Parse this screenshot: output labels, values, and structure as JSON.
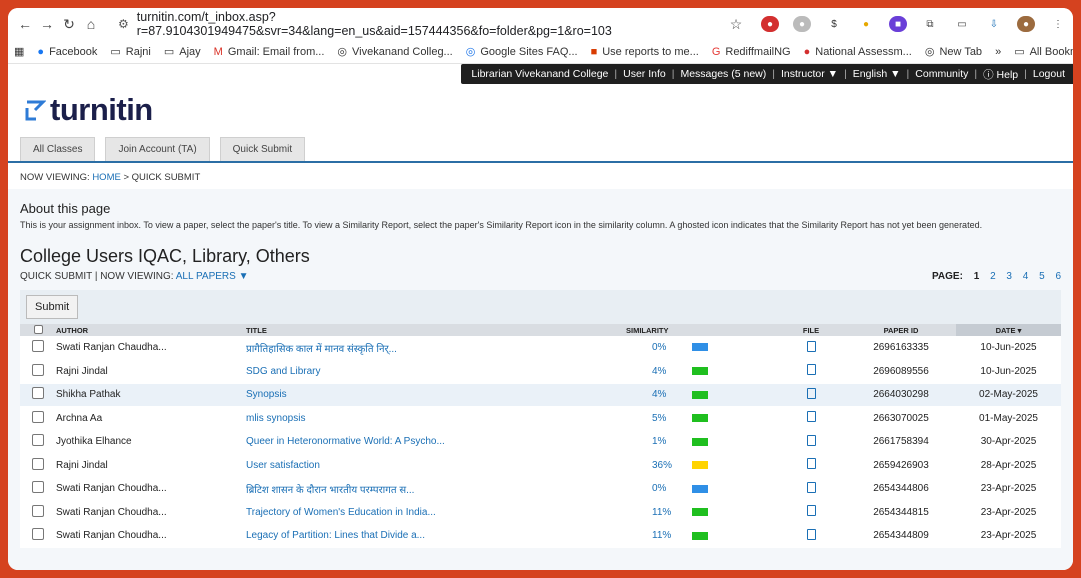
{
  "browser": {
    "url": "turnitin.com/t_inbox.asp?r=87.9104301949475&svr=34&lang=en_us&aid=157444356&fo=folder&pg=1&ro=103",
    "bookmarks": [
      "Facebook",
      "Rajni",
      "Ajay",
      "Gmail: Email from...",
      "Vivekanand Colleg...",
      "Google Sites FAQ...",
      "Use reports to me...",
      "RediffmailNG",
      "National Assessm...",
      "New Tab"
    ],
    "all_bookmarks": "All Bookmarks"
  },
  "topnav": [
    "Librarian Vivekanand College",
    "User Info",
    "Messages (5 new)",
    "Instructor ▼",
    "English ▼",
    "Community",
    "ⓘ Help",
    "Logout"
  ],
  "logo": "turnitin",
  "tabs": [
    "All Classes",
    "Join Account (TA)",
    "Quick Submit"
  ],
  "breadcrumb": {
    "prefix": "NOW VIEWING: ",
    "home": "HOME",
    "rest": " > QUICK SUBMIT"
  },
  "about": {
    "title": "About this page",
    "text": "This is your assignment inbox. To view a paper, select the paper's title. To view a Similarity Report, select the paper's Similarity Report icon in the similarity column. A ghosted icon indicates that the Similarity Report has not yet been generated."
  },
  "class_title": "College Users IQAC, Library, Others",
  "subline": {
    "prefix": "QUICK SUBMIT | NOW VIEWING: ",
    "link": "ALL PAPERS ▼"
  },
  "pager": {
    "label": "PAGE:",
    "pages": [
      "1",
      "2",
      "3",
      "4",
      "5",
      "6"
    ]
  },
  "submit": "Submit",
  "columns": [
    "AUTHOR",
    "TITLE",
    "SIMILARITY",
    "FILE",
    "PAPER ID",
    "DATE"
  ],
  "colors": {
    "blue": "#2f8fe6",
    "green": "#1fbf1f",
    "yellow": "#ffd400"
  },
  "rows": [
    {
      "author": "Swati Ranjan Chaudha...",
      "title": "प्रागैतिहासिक काल में मानव संस्कृति निर्...",
      "sim": "0%",
      "color": "blue",
      "id": "2696163335",
      "date": "10-Jun-2025"
    },
    {
      "author": "Rajni Jindal",
      "title": "SDG and Library",
      "sim": "4%",
      "color": "green",
      "id": "2696089556",
      "date": "10-Jun-2025"
    },
    {
      "author": "Shikha Pathak",
      "title": "Synopsis",
      "sim": "4%",
      "color": "green",
      "id": "2664030298",
      "date": "02-May-2025"
    },
    {
      "author": "Archna Aa",
      "title": "mlis synopsis",
      "sim": "5%",
      "color": "green",
      "id": "2663070025",
      "date": "01-May-2025"
    },
    {
      "author": "Jyothika Elhance",
      "title": "Queer in Heteronormative World: A Psycho...",
      "sim": "1%",
      "color": "green",
      "id": "2661758394",
      "date": "30-Apr-2025"
    },
    {
      "author": "Rajni Jindal",
      "title": "User satisfaction",
      "sim": "36%",
      "color": "yellow",
      "id": "2659426903",
      "date": "28-Apr-2025"
    },
    {
      "author": "Swati Ranjan Choudha...",
      "title": "ब्रिटिश शासन के दौरान भारतीय परम्परागत स...",
      "sim": "0%",
      "color": "blue",
      "id": "2654344806",
      "date": "23-Apr-2025"
    },
    {
      "author": "Swati Ranjan Choudha...",
      "title": "Trajectory of Women's Education in India...",
      "sim": "11%",
      "color": "green",
      "id": "2654344815",
      "date": "23-Apr-2025"
    },
    {
      "author": "Swati Ranjan Choudha...",
      "title": "Legacy of Partition: Lines that Divide a...",
      "sim": "11%",
      "color": "green",
      "id": "2654344809",
      "date": "23-Apr-2025"
    }
  ]
}
